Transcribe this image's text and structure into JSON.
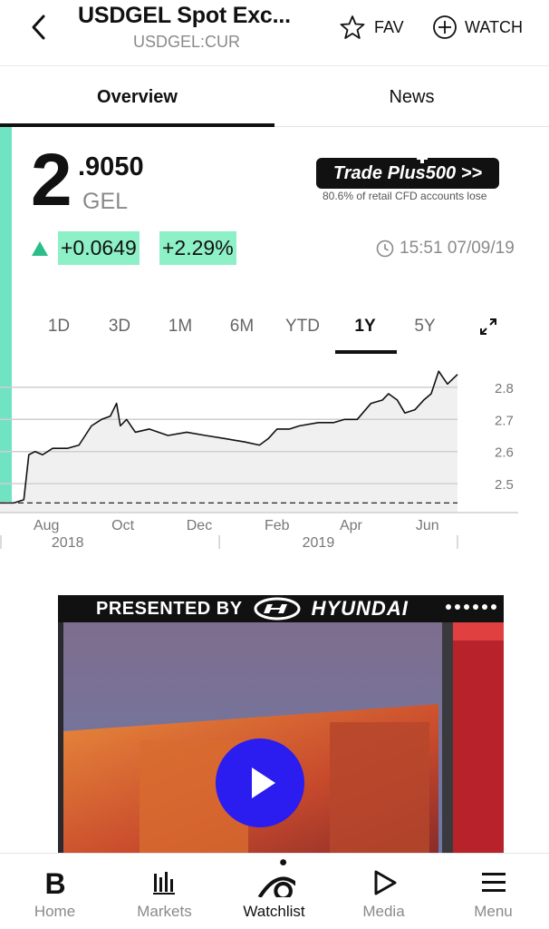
{
  "header": {
    "title": "USDGEL Spot Exc...",
    "ticker": "USDGEL:CUR",
    "fav_label": "FAV",
    "watch_label": "WATCH"
  },
  "tabs": [
    {
      "label": "Overview",
      "active": true
    },
    {
      "label": "News",
      "active": false
    }
  ],
  "quote": {
    "price_integer": "2",
    "price_decimal": ".9050",
    "currency": "GEL",
    "change_abs": "+0.0649",
    "change_pct": "+2.29%",
    "direction": "up",
    "timestamp": "15:51 07/09/19"
  },
  "ad": {
    "text": "Trade Plus500 >>",
    "disclaimer": "80.6% of retail CFD accounts lose"
  },
  "ranges": [
    "1D",
    "3D",
    "1M",
    "6M",
    "YTD",
    "1Y",
    "5Y"
  ],
  "active_range": "1Y",
  "chart_data": {
    "type": "area",
    "x": [
      "2018-07-09",
      "2018-07-20",
      "2018-07-28",
      "2018-08-01",
      "2018-08-06",
      "2018-08-12",
      "2018-08-20",
      "2018-09-01",
      "2018-09-10",
      "2018-09-20",
      "2018-09-28",
      "2018-10-05",
      "2018-10-10",
      "2018-10-13",
      "2018-10-18",
      "2018-10-25",
      "2018-11-05",
      "2018-11-20",
      "2018-12-05",
      "2018-12-20",
      "2019-01-05",
      "2019-01-20",
      "2019-02-01",
      "2019-02-08",
      "2019-02-15",
      "2019-02-25",
      "2019-03-05",
      "2019-03-20",
      "2019-04-01",
      "2019-04-10",
      "2019-04-20",
      "2019-05-01",
      "2019-05-10",
      "2019-05-15",
      "2019-05-22",
      "2019-05-28",
      "2019-06-05",
      "2019-06-12",
      "2019-06-18",
      "2019-06-24",
      "2019-07-01",
      "2019-07-09"
    ],
    "values": [
      2.44,
      2.44,
      2.45,
      2.59,
      2.6,
      2.59,
      2.61,
      2.61,
      2.62,
      2.68,
      2.7,
      2.71,
      2.75,
      2.68,
      2.7,
      2.66,
      2.67,
      2.65,
      2.66,
      2.65,
      2.64,
      2.63,
      2.62,
      2.64,
      2.67,
      2.67,
      2.68,
      2.69,
      2.69,
      2.7,
      2.7,
      2.75,
      2.76,
      2.78,
      2.76,
      2.72,
      2.73,
      2.76,
      2.78,
      2.85,
      2.81,
      2.84
    ],
    "y_ticks": [
      "2.8",
      "2.7",
      "2.6",
      "2.5"
    ],
    "ylim": [
      2.41,
      2.89
    ],
    "x_tick_labels": [
      "Aug",
      "Oct",
      "Dec",
      "Feb",
      "Apr",
      "Jun"
    ],
    "year_labels": [
      "2018",
      "2019"
    ],
    "reference_line": 2.44,
    "grid": true,
    "line_color": "#111111",
    "fill_color": "#f0f0f0"
  },
  "video": {
    "presented_by": "PRESENTED BY",
    "sponsor": "HYUNDAI",
    "play_color": "#2b1cf0"
  },
  "bottom_nav": [
    {
      "label": "Home",
      "icon": "bloomberg-b-icon",
      "active": false
    },
    {
      "label": "Markets",
      "icon": "markets-bars-icon",
      "active": false
    },
    {
      "label": "Watchlist",
      "icon": "watchlist-eye-icon",
      "active": true
    },
    {
      "label": "Media",
      "icon": "play-outline-icon",
      "active": false
    },
    {
      "label": "Menu",
      "icon": "hamburger-icon",
      "active": false
    }
  ],
  "colors": {
    "accent": "#6fe3c2",
    "positive": "#8ef0c6",
    "up_arrow": "#2dbd8a"
  }
}
